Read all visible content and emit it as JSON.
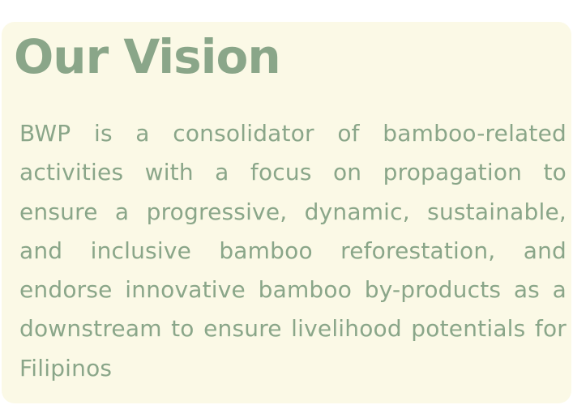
{
  "vision": {
    "title": "Our Vision",
    "body": "BWP is a consolidator of bamboo-related activities with a focus on propagation to ensure a progressive, dynamic, sustainable, and inclusive bamboo reforestation, and endorse innovative bamboo by-products as a downstream to ensure livelihood potentials for Filipinos"
  },
  "colors": {
    "card_background": "#fbf9e6",
    "text": "#8aa689"
  }
}
